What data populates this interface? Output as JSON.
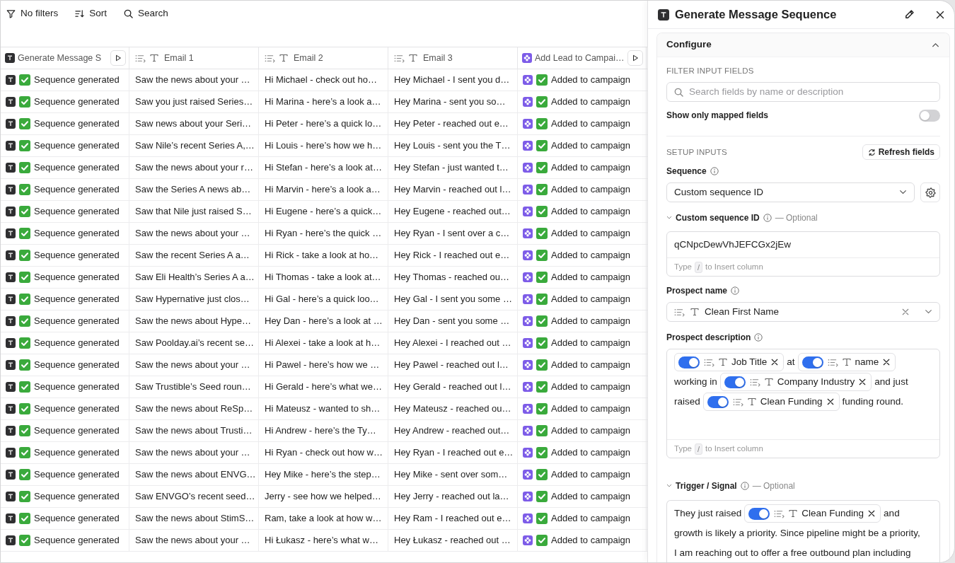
{
  "toolbar": [
    {
      "kind": "filter",
      "label": "No filters"
    },
    {
      "kind": "sort",
      "label": "Sort"
    },
    {
      "kind": "search",
      "label": "Search"
    }
  ],
  "table": {
    "columns": [
      {
        "kind": "generator",
        "label": "Generate Message S"
      },
      {
        "kind": "text",
        "label": "Email 1"
      },
      {
        "kind": "text",
        "label": "Email 2"
      },
      {
        "kind": "text",
        "label": "Email 3"
      },
      {
        "kind": "campaign",
        "label": "Add Lead to Campai…"
      }
    ],
    "rows": [
      {
        "cells": [
          "Sequence generated",
          "Saw the news about your …",
          "Hi Michael - check out ho…",
          "Hey Michael - I sent you d…",
          "Added to campaign"
        ]
      },
      {
        "cells": [
          "Sequence generated",
          "Saw you just raised Series…",
          "Hi Marina - here’s a look a…",
          "Hey Marina - sent you so…",
          "Added to campaign"
        ]
      },
      {
        "cells": [
          "Sequence generated",
          "Saw news about your Seri…",
          "Hi Peter - here’s a quick lo…",
          "Hey Peter - reached out e…",
          "Added to campaign"
        ]
      },
      {
        "cells": [
          "Sequence generated",
          "Saw Nile’s recent Series A,…",
          "Hi Louis - here’s how we h…",
          "Hey Louis - sent you the T…",
          "Added to campaign"
        ]
      },
      {
        "cells": [
          "Sequence generated",
          "Saw the news about your r…",
          "Hi Stefan - here’s a look at…",
          "Hey Stefan - just wanted t…",
          "Added to campaign"
        ]
      },
      {
        "cells": [
          "Sequence generated",
          "Saw the Series A news ab…",
          "Hi Marvin - here’s a look a…",
          "Hey Marvin - reached out l…",
          "Added to campaign"
        ]
      },
      {
        "cells": [
          "Sequence generated",
          "Saw that Nile just raised S…",
          "Hi Eugene - here’s a quick…",
          "Hey Eugene - reached out…",
          "Added to campaign"
        ]
      },
      {
        "cells": [
          "Sequence generated",
          "Saw the news about your …",
          "Hi Ryan - here’s the quick …",
          "Hey Ryan - I sent over a c…",
          "Added to campaign"
        ]
      },
      {
        "cells": [
          "Sequence generated",
          "Saw the recent Series A a…",
          "Hi Rick - take a look at ho…",
          "Hey Rick - I reached out e…",
          "Added to campaign"
        ]
      },
      {
        "cells": [
          "Sequence generated",
          "Saw Eli Health’s Series A a…",
          "Hi Thomas - take a look at…",
          "Hey Thomas - reached ou…",
          "Added to campaign"
        ]
      },
      {
        "cells": [
          "Sequence generated",
          "Saw Hypernative just clos…",
          "Hi Gal - here’s a quick loo…",
          "Hey Gal - I sent you some …",
          "Added to campaign"
        ]
      },
      {
        "cells": [
          "Sequence generated",
          "Saw the news about Hype…",
          "Hey Dan - here’s a look at …",
          "Hey Dan - sent you some …",
          "Added to campaign"
        ]
      },
      {
        "cells": [
          "Sequence generated",
          "Saw Poolday.ai’s recent se…",
          "Hi Alexei - take a look at h…",
          "Hey Alexei - I reached out …",
          "Added to campaign"
        ]
      },
      {
        "cells": [
          "Sequence generated",
          "Saw the news about your …",
          "Hi Pawel - here’s how we …",
          "Hey Pawel - reached out l…",
          "Added to campaign"
        ]
      },
      {
        "cells": [
          "Sequence generated",
          "Saw Trustible’s Seed roun…",
          "Hi Gerald - here’s what we…",
          "Hey Gerald - reached out l…",
          "Added to campaign"
        ]
      },
      {
        "cells": [
          "Sequence generated",
          "Saw the news about ReSp…",
          "Hi Mateusz - wanted to sh…",
          "Hey Mateusz - reached ou…",
          "Added to campaign"
        ]
      },
      {
        "cells": [
          "Sequence generated",
          "Saw the news about Trusti…",
          "Hi Andrew - here’s the Ty…",
          "Hey Andrew - reached out…",
          "Added to campaign"
        ]
      },
      {
        "cells": [
          "Sequence generated",
          "Saw the news about your …",
          "Hi Ryan - check out how w…",
          "Hey Ryan - I reached out e…",
          "Added to campaign"
        ]
      },
      {
        "cells": [
          "Sequence generated",
          "Saw the news about ENVG…",
          "Hey Mike - here’s the step…",
          "Hey Mike - sent over som…",
          "Added to campaign"
        ]
      },
      {
        "cells": [
          "Sequence generated",
          "Saw ENVGO’s recent seed…",
          "Jerry - see how we helped…",
          "Hey Jerry - reached out la…",
          "Added to campaign"
        ]
      },
      {
        "cells": [
          "Sequence generated",
          "Saw the news about StimS…",
          "Ram, take a look at how w…",
          "Hey Ram - I reached out e…",
          "Added to campaign"
        ]
      },
      {
        "cells": [
          "Sequence generated",
          "Saw the news about your …",
          "Hi Łukasz - here’s what w…",
          "Hey Łukasz - reached out …",
          "Added to campaign"
        ]
      }
    ]
  },
  "panel": {
    "title": "Generate Message Sequence",
    "section": {
      "title": "Configure",
      "expanded": true
    },
    "filter": {
      "heading": "FILTER INPUT FIELDS",
      "placeholder": "Search fields by name or description",
      "toggle": {
        "label": "Show only mapped fields",
        "on": false
      }
    },
    "setup": {
      "heading": "SETUP INPUTS",
      "refresh": "Refresh fields",
      "fields": [
        {
          "kind": "select",
          "label": "Sequence",
          "value": "Custom sequence ID"
        },
        {
          "kind": "text",
          "label": "Custom sequence ID",
          "optional": "— Optional",
          "expanded": true,
          "value": "qCNpcDewVhJEFCGx2jEw",
          "hint": {
            "before": "Type",
            "key": "/",
            "after": "to Insert column"
          }
        },
        {
          "kind": "column",
          "label": "Prospect name",
          "value": "Clean First Name"
        },
        {
          "kind": "rich",
          "label": "Prospect description",
          "segments": [
            {
              "kind": "chip",
              "label": "Job Title",
              "on": true
            },
            {
              "kind": "text",
              "text": "at"
            },
            {
              "kind": "chip",
              "label": "name",
              "on": true
            },
            {
              "kind": "text",
              "text": "working in"
            },
            {
              "kind": "chip",
              "label": "Company Industry",
              "on": true
            },
            {
              "kind": "text",
              "text": "and just"
            },
            {
              "kind": "text",
              "text": "raised"
            },
            {
              "kind": "chip",
              "label": "Clean Funding",
              "on": true
            },
            {
              "kind": "text",
              "text": "funding round."
            }
          ],
          "hint": {
            "before": "Type",
            "key": "/",
            "after": "to Insert column"
          }
        },
        {
          "kind": "rich",
          "label": "Trigger / Signal",
          "optional": "— Optional",
          "expanded": true,
          "segments": [
            {
              "kind": "text",
              "text": "They just raised"
            },
            {
              "kind": "chip",
              "label": "Clean Funding",
              "on": true
            },
            {
              "kind": "text",
              "text": "and"
            },
            {
              "kind": "text",
              "text": "growth is likely a priority. Since pipeline might be a priority,"
            },
            {
              "kind": "text",
              "text": "I am reaching out to offer a free outbound plan including"
            }
          ]
        }
      ]
    }
  }
}
